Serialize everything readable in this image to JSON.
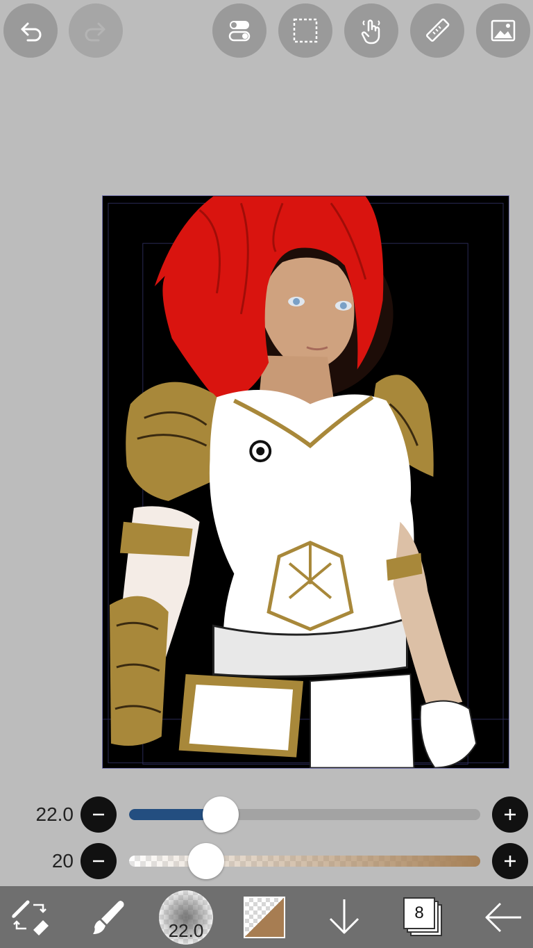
{
  "toolbar": {
    "undo_icon": "undo-icon",
    "redo_icon": "redo-icon",
    "toggle_icon": "toggle-settings-icon",
    "selection_icon": "selection-rectangle-icon",
    "hand_icon": "hand-tool-icon",
    "ruler_icon": "ruler-icon",
    "image_icon": "image-icon"
  },
  "brush_size": {
    "value": "22.0",
    "level": 0.26,
    "fill_color": "#234e80"
  },
  "opacity": {
    "value": "20",
    "level": 0.22,
    "color": "#a68056"
  },
  "bottom": {
    "brush_preview_value": "22.0",
    "layers_count": "8",
    "primary_color": "#a77d52"
  }
}
